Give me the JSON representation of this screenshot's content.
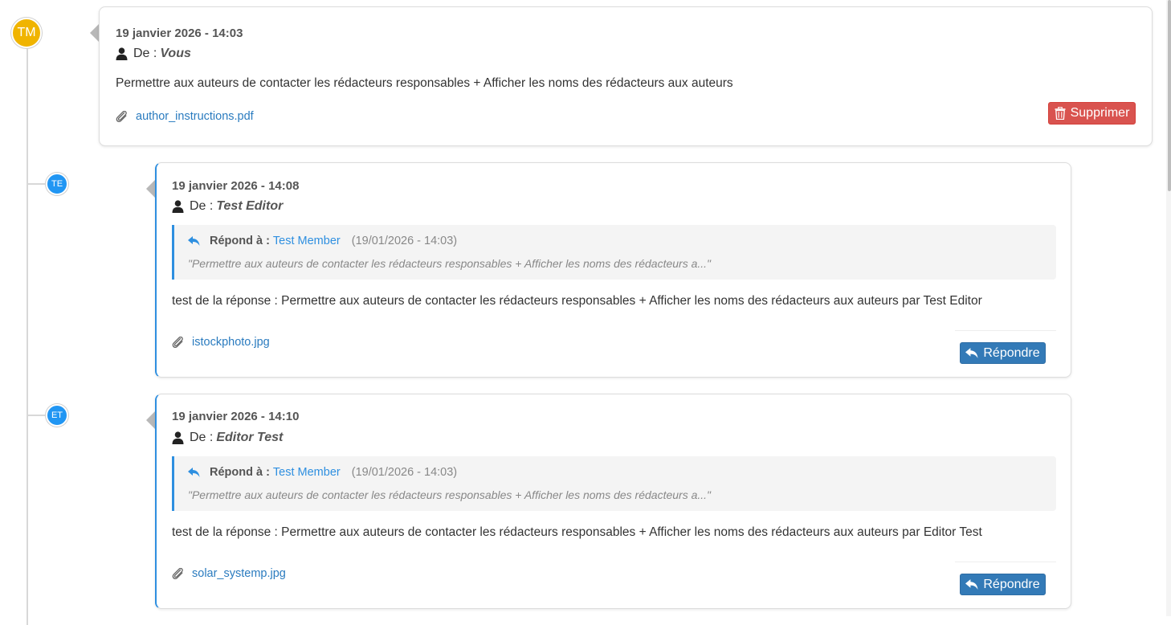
{
  "timeline": {
    "avatars": [
      {
        "initials": "TM",
        "color": "#f0b400"
      },
      {
        "initials": "TE",
        "color": "#2196f3"
      },
      {
        "initials": "ET",
        "color": "#2196f3"
      }
    ]
  },
  "messages": [
    {
      "date": "19 janvier 2026 - 14:03",
      "from_label": "De :",
      "from_name": "Vous",
      "body": "Permettre aux auteurs de contacter les rédacteurs responsables + Afficher les noms des rédacteurs aux auteurs",
      "attachment": "author_instructions.pdf",
      "action_label": "Supprimer"
    },
    {
      "date": "19 janvier 2026 - 14:08",
      "from_label": "De :",
      "from_name": "Test Editor",
      "reply_to": {
        "label": "Répond à :",
        "author": "Test Member",
        "timestamp": "(19/01/2026 - 14:03)",
        "excerpt": "\"Permettre aux auteurs de contacter les rédacteurs responsables + Afficher les noms des rédacteurs a...\""
      },
      "body": "test de la réponse : Permettre aux auteurs de contacter les rédacteurs responsables + Afficher les noms des rédacteurs aux auteurs par Test Editor",
      "attachment": "istockphoto.jpg",
      "action_label": "Répondre"
    },
    {
      "date": "19 janvier 2026 - 14:10",
      "from_label": "De :",
      "from_name": "Editor Test",
      "reply_to": {
        "label": "Répond à :",
        "author": "Test Member",
        "timestamp": "(19/01/2026 - 14:03)",
        "excerpt": "\"Permettre aux auteurs de contacter les rédacteurs responsables + Afficher les noms des rédacteurs a...\""
      },
      "body": "test de la réponse : Permettre aux auteurs de contacter les rédacteurs responsables + Afficher les noms des rédacteurs aux auteurs par Editor Test",
      "attachment": "solar_systemp.jpg",
      "action_label": "Répondre"
    }
  ],
  "icons": {
    "person": "user-icon",
    "attachment": "paperclip-icon",
    "delete": "trash-icon",
    "reply": "reply-icon"
  },
  "colors": {
    "accent": "#2e8fe0",
    "danger": "#d9534f",
    "primary": "#337ab7",
    "avatar_self": "#f0b400"
  }
}
